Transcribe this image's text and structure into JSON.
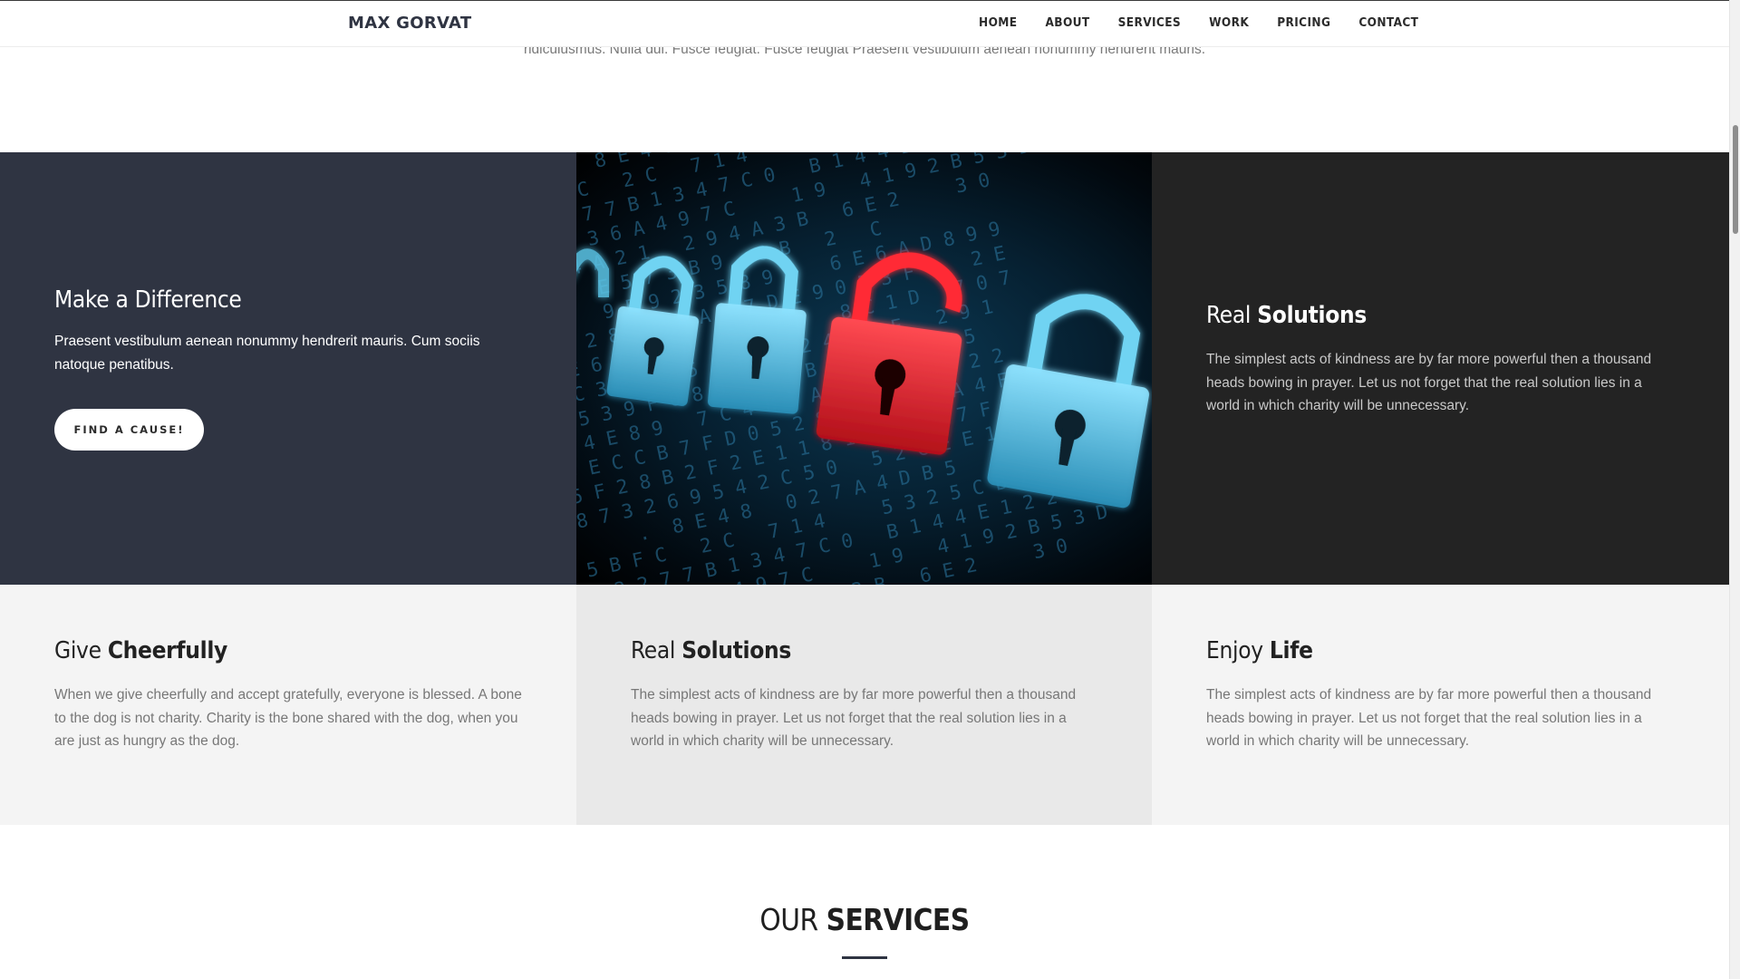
{
  "header": {
    "logo": "MAX GORVAT",
    "nav": [
      {
        "label": "HOME"
      },
      {
        "label": "ABOUT"
      },
      {
        "label": "SERVICES"
      },
      {
        "label": "WORK"
      },
      {
        "label": "PRICING"
      },
      {
        "label": "CONTACT"
      }
    ]
  },
  "intro": {
    "text": "ridiculusmus. Nulla dui. Fusce feugiat. Fusce feugiat Praesent vestibulum aenean nonummy hendrerit mauris."
  },
  "features": {
    "left": {
      "title": "Make a Difference",
      "text": "Praesent vestibulum aenean nonummy hendrerit mauris. Cum sociis natoque penatibus.",
      "button": "FIND A CAUSE!"
    },
    "image": {
      "alt_icon": "padlocks-security-image",
      "code_lines": [
        "  D      .  8 E 4 8   0 2 7 A 4 D B 5",
        "8 5 5 B F C   2 C   7 1 4     5 3 2 5 C B 7 3",
        "F 5 3 2 2 7 7 B 1 3 4 7 C 0   B 1 4 4 E 1 2 2",
        "    B 1 9 3 6 A 4 9 7 C     1 9   4 1 9 2 B 5 3 D",
        "C 3 A C 4 A 2 1   2 9 4 A 3 B   6 E 2     3 0",
        "A 8 5 B   E 5 7 3 B 9   8 B   2   C",
        "  4 8     9 B 9 2 3 5 8 9 A   6 E 6 A D 8 9 9",
        "6 1 7 C 2 8     A A 3 7 D E 9 0 5 3 F 0   2 E",
        "5 A 2 E 6 7 0   D   9 8 7 D   8 C 1 D   7 0 7",
        "A 0 E C 3 F   2 5 A 3 5 7 2 4 2 7 F   2 9 1",
        "D 8 F 5 3 9 F 0 8 9   C 4 B D E A 5 1 2 5",
        "B 5 C 4 E 8 9   7 C 4 B 5 A   3 4 4 E 1 2 2",
        "  B 5 E C C B 7 F D 0 5 2 8 E 4   D 3 A 4 F",
        "A 0 5 F 2 8 B 2 F 2 E 1 1 8 1 0 7   E 7 F 8 3",
        "  6 8 7 3 2 6 9 5 4 2 C 5 0   5 2 C E E 1 0 8"
      ]
    },
    "right": {
      "title_light": "Real",
      "title_bold": "Solutions",
      "text": "The simplest acts of kindness are by far more powerful then a thousand heads bowing in prayer. Let us not forget that the real solution lies in a world in which charity will be unnecessary."
    }
  },
  "info": [
    {
      "title_light": "Give",
      "title_bold": "Cheerfully",
      "text": "When we give cheerfully and accept gratefully, everyone is blessed. A bone to the dog is not charity. Charity is the bone shared with the dog, when you are just as hungry as the dog."
    },
    {
      "title_light": "Real",
      "title_bold": "Solutions",
      "text": "The simplest acts of kindness are by far more powerful then a thousand heads bowing in prayer. Let us not forget that the real solution lies in a world in which charity will be unnecessary."
    },
    {
      "title_light": "Enjoy",
      "title_bold": "Life",
      "text": "The simplest acts of kindness are by far more powerful then a thousand heads bowing in prayer. Let us not forget that the real solution lies in a world in which charity will be unnecessary."
    }
  ],
  "services": {
    "title_light": "OUR",
    "title_bold": "SERVICES"
  },
  "colors": {
    "dark_panel": "#2f3442",
    "black_panel": "#232323",
    "info_bg": "#f4f4f4",
    "info_mid_bg": "#e9e9e9",
    "lock_blue": "#5cc6e8",
    "lock_red": "#e3232f"
  }
}
